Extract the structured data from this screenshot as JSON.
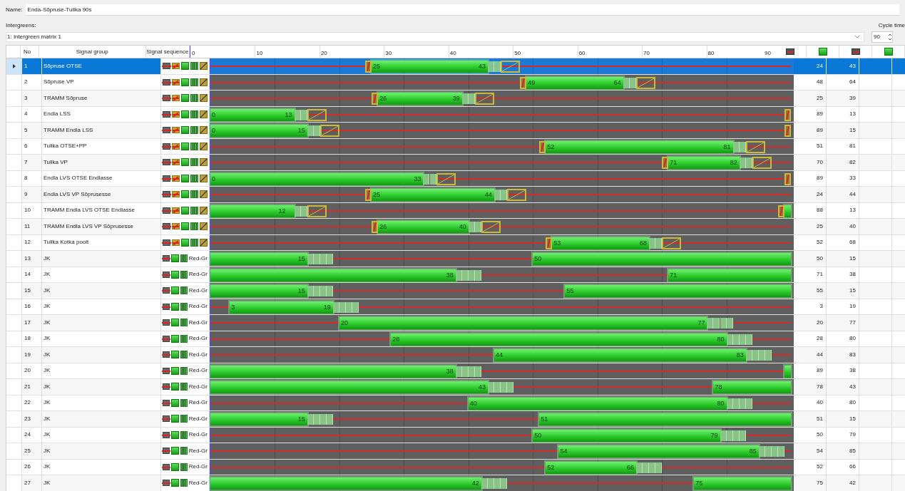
{
  "name_field": {
    "label": "Name:",
    "value": "Enda-Sõpruse-Tulika 90s"
  },
  "intergreens": {
    "label": "Intergreens:",
    "value": "1: Intergreen matrix 1"
  },
  "cycle_time": {
    "label": "Cycle time",
    "value": "90"
  },
  "table": {
    "columns": [
      "No",
      "Signal group",
      "Signal sequence"
    ],
    "axis_labels": [
      "0",
      "10",
      "20",
      "30",
      "40",
      "50",
      "60",
      "70",
      "80",
      "90"
    ],
    "time_columns": [
      {
        "kind": "stop"
      },
      {
        "kind": "go"
      },
      {
        "kind": "stop"
      },
      {
        "kind": "go"
      }
    ],
    "rows": [
      {
        "no": "1",
        "name": "Sõpruse OTSE",
        "kind": "vehicle",
        "selected": true,
        "red_end": "24",
        "green_end": "43",
        "bar_labels": [
          "25",
          "43"
        ]
      },
      {
        "no": "2",
        "name": "Sõpruse VP",
        "kind": "vehicle",
        "selected": false,
        "red_end": "48",
        "green_end": "64",
        "bar_labels": [
          "49",
          "64"
        ]
      },
      {
        "no": "3",
        "name": "TRAMM Sõpruse",
        "kind": "vehicle",
        "selected": false,
        "red_end": "25",
        "green_end": "39",
        "bar_labels": [
          "26",
          "39"
        ]
      },
      {
        "no": "4",
        "name": "Endla LSS",
        "kind": "vehicle",
        "selected": false,
        "red_end": "89",
        "green_end": "13",
        "bar_labels": [
          "0",
          "13"
        ]
      },
      {
        "no": "5",
        "name": "TRAMM Endla LSS",
        "kind": "vehicle",
        "selected": false,
        "red_end": "89",
        "green_end": "15",
        "bar_labels": [
          "0",
          "15"
        ]
      },
      {
        "no": "6",
        "name": "Tulika OTSE+PP",
        "kind": "vehicle",
        "selected": false,
        "red_end": "51",
        "green_end": "81",
        "bar_labels": [
          "52",
          "81"
        ]
      },
      {
        "no": "7",
        "name": "Tulika VP",
        "kind": "vehicle",
        "selected": false,
        "red_end": "70",
        "green_end": "82",
        "bar_labels": [
          "71",
          "82"
        ]
      },
      {
        "no": "8",
        "name": "Endla LVS OTSE Endlasse",
        "kind": "vehicle",
        "selected": false,
        "red_end": "89",
        "green_end": "33",
        "bar_labels": [
          "0",
          "33"
        ]
      },
      {
        "no": "9",
        "name": "Endla LVS VP Sõprusesse",
        "kind": "vehicle",
        "selected": false,
        "red_end": "24",
        "green_end": "44",
        "bar_labels": [
          "25",
          "44"
        ]
      },
      {
        "no": "10",
        "name": "TRAMM Endla LVS OTSE Endlasse",
        "kind": "vehicle",
        "selected": false,
        "red_end": "88",
        "green_end": "13",
        "bar_labels": [
          "12"
        ]
      },
      {
        "no": "11",
        "name": "TRAMM Endla LVS VP Sõprusesse",
        "kind": "vehicle",
        "selected": false,
        "red_end": "25",
        "green_end": "40",
        "bar_labels": [
          "26",
          "40"
        ]
      },
      {
        "no": "12",
        "name": "Tulika Kotka poolt",
        "kind": "vehicle",
        "selected": false,
        "red_end": "52",
        "green_end": "68",
        "bar_labels": [
          "53",
          "68"
        ]
      },
      {
        "no": "13",
        "name": "JK",
        "kind": "pedestrian",
        "sequence_label": "Red-Gr",
        "selected": false,
        "red_end": "50",
        "green_end": "15",
        "bar_labels": [
          "15",
          "50"
        ]
      },
      {
        "no": "14",
        "name": "JK",
        "kind": "pedestrian",
        "sequence_label": "Red-Gr",
        "selected": false,
        "red_end": "71",
        "green_end": "38",
        "bar_labels": [
          "38",
          "71"
        ]
      },
      {
        "no": "15",
        "name": "JK",
        "kind": "pedestrian",
        "sequence_label": "Red-Gr",
        "selected": false,
        "red_end": "55",
        "green_end": "15",
        "bar_labels": [
          "15",
          "55"
        ]
      },
      {
        "no": "16",
        "name": "JK",
        "kind": "pedestrian",
        "sequence_label": "Red-Gr",
        "selected": false,
        "red_end": "3",
        "green_end": "19",
        "bar_labels": [
          "3",
          "19"
        ]
      },
      {
        "no": "17",
        "name": "JK",
        "kind": "pedestrian",
        "sequence_label": "Red-Gr",
        "selected": false,
        "red_end": "20",
        "green_end": "77",
        "bar_labels": [
          "20",
          "77"
        ]
      },
      {
        "no": "18",
        "name": "JK",
        "kind": "pedestrian",
        "sequence_label": "Red-Gr",
        "selected": false,
        "red_end": "28",
        "green_end": "80",
        "bar_labels": [
          "28",
          "80"
        ]
      },
      {
        "no": "19",
        "name": "JK",
        "kind": "pedestrian",
        "sequence_label": "Red-Gr",
        "selected": false,
        "red_end": "44",
        "green_end": "83",
        "bar_labels": [
          "44",
          "83"
        ]
      },
      {
        "no": "20",
        "name": "JK",
        "kind": "pedestrian",
        "sequence_label": "Red-Gr",
        "selected": false,
        "red_end": "89",
        "green_end": "38",
        "bar_labels": [
          "38"
        ]
      },
      {
        "no": "21",
        "name": "JK",
        "kind": "pedestrian",
        "sequence_label": "Red-Gr",
        "selected": false,
        "red_end": "78",
        "green_end": "43",
        "bar_labels": [
          "43",
          "78"
        ]
      },
      {
        "no": "22",
        "name": "JK",
        "kind": "pedestrian",
        "sequence_label": "Red-Gr",
        "selected": false,
        "red_end": "40",
        "green_end": "80",
        "bar_labels": [
          "40",
          "80"
        ]
      },
      {
        "no": "23",
        "name": "JK",
        "kind": "pedestrian",
        "sequence_label": "Red-Gr",
        "selected": false,
        "red_end": "51",
        "green_end": "15",
        "bar_labels": [
          "15",
          "51"
        ]
      },
      {
        "no": "24",
        "name": "JK",
        "kind": "pedestrian",
        "sequence_label": "Red-Gr",
        "selected": false,
        "red_end": "50",
        "green_end": "79",
        "bar_labels": [
          "50",
          "79"
        ]
      },
      {
        "no": "25",
        "name": "JK",
        "kind": "pedestrian",
        "sequence_label": "Red-Gr",
        "selected": false,
        "red_end": "54",
        "green_end": "85",
        "bar_labels": [
          "54",
          "85"
        ]
      },
      {
        "no": "26",
        "name": "JK",
        "kind": "pedestrian",
        "sequence_label": "Red-Gr",
        "selected": false,
        "red_end": "52",
        "green_end": "66",
        "bar_labels": [
          "52",
          "66"
        ]
      },
      {
        "no": "27",
        "name": "JK",
        "kind": "pedestrian",
        "sequence_label": "Red-Gr",
        "selected": false,
        "red_end": "75",
        "green_end": "42",
        "bar_labels": [
          "42",
          "75"
        ]
      }
    ]
  }
}
